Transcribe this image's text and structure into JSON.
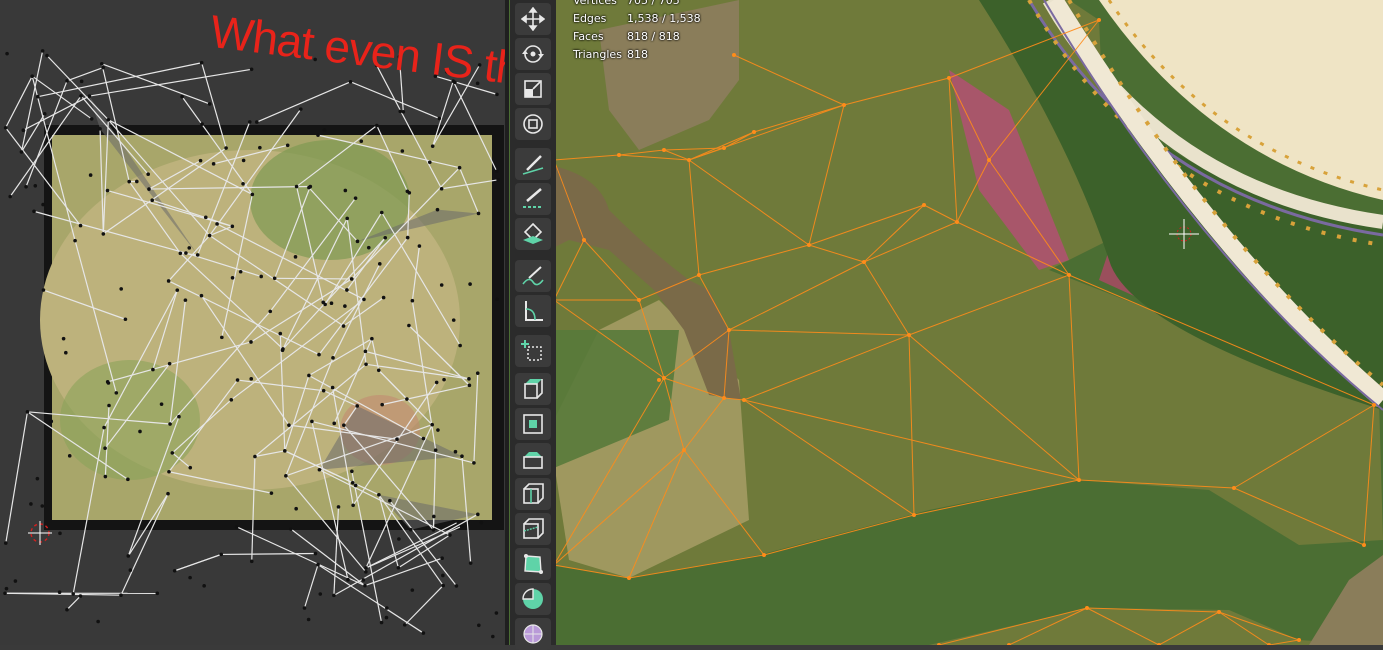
{
  "annotation": {
    "text": "What even IS this"
  },
  "overlay_stats": {
    "rows": [
      {
        "label": "Vertices",
        "value": "705 / 705"
      },
      {
        "label": "Edges",
        "value": "1,538 / 1,538"
      },
      {
        "label": "Faces",
        "value": "818 / 818"
      },
      {
        "label": "Triangles",
        "value": "818"
      }
    ]
  },
  "toolbar": {
    "tools": [
      {
        "name": "move-tool",
        "icon": "move-icon"
      },
      {
        "name": "rotate-tool",
        "icon": "rotate-icon"
      },
      {
        "name": "scale-tool",
        "icon": "scale-icon"
      },
      {
        "name": "transform-tool",
        "icon": "transform-icon"
      },
      {
        "name": "annotate-tool",
        "icon": "annotate-icon"
      },
      {
        "name": "annotate-line-tool",
        "icon": "annotate-line-icon"
      },
      {
        "name": "annotate-polygon-tool",
        "icon": "annotate-polygon-icon"
      },
      {
        "name": "annotate-eraser-tool",
        "icon": "annotate-freehand-icon"
      },
      {
        "name": "measure-tool",
        "icon": "measure-icon"
      },
      {
        "name": "add-cube-tool",
        "icon": "add-cube-icon"
      },
      {
        "name": "extrude-region-tool",
        "icon": "extrude-icon"
      },
      {
        "name": "inset-faces-tool",
        "icon": "inset-icon"
      },
      {
        "name": "bevel-tool",
        "icon": "bevel-icon"
      },
      {
        "name": "loop-cut-tool",
        "icon": "loop-cut-icon"
      },
      {
        "name": "knife-tool",
        "icon": "knife-icon"
      },
      {
        "name": "poly-build-tool",
        "icon": "poly-build-icon"
      },
      {
        "name": "spin-tool",
        "icon": "spin-icon"
      },
      {
        "name": "smooth-tool",
        "icon": "smooth-icon"
      }
    ]
  },
  "colors": {
    "annotation": "#e8231a",
    "wire_selected": "#ff8c1a",
    "uv_wire": "#e6e6e6",
    "ground": "#4b6e33",
    "tool_bg": "#3b3b3b",
    "toolbar_bg": "#2b2b2b"
  }
}
